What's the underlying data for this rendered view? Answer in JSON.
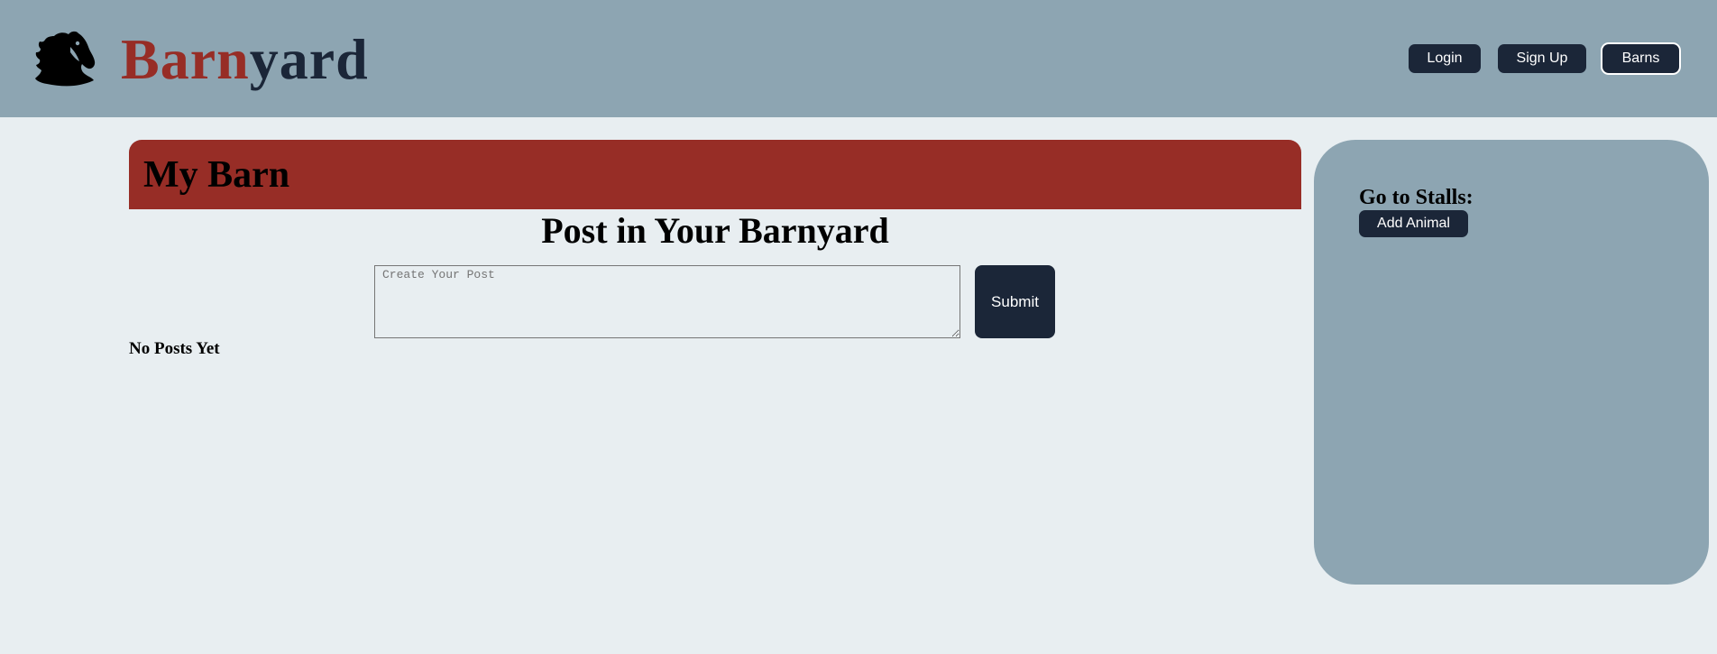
{
  "header": {
    "brand_part1": "Barn",
    "brand_part2": "yard",
    "logo_icon": "horse-head-icon",
    "nav": {
      "login_label": "Login",
      "signup_label": "Sign Up",
      "barns_label": "Barns"
    }
  },
  "main": {
    "barn_title": "My Barn",
    "post_heading": "Post in Your Barnyard",
    "post_placeholder": "Create Your Post",
    "post_value": "",
    "submit_label": "Submit",
    "empty_message": "No Posts Yet"
  },
  "sidebar": {
    "heading": "Go to Stalls:",
    "add_animal_label": "Add Animal"
  },
  "colors": {
    "header_bg": "#8da5b2",
    "page_bg": "#e8eef1",
    "brand_red": "#972d26",
    "brand_navy": "#1b2638",
    "button_bg": "#1b2638",
    "button_text": "#ffffff"
  }
}
